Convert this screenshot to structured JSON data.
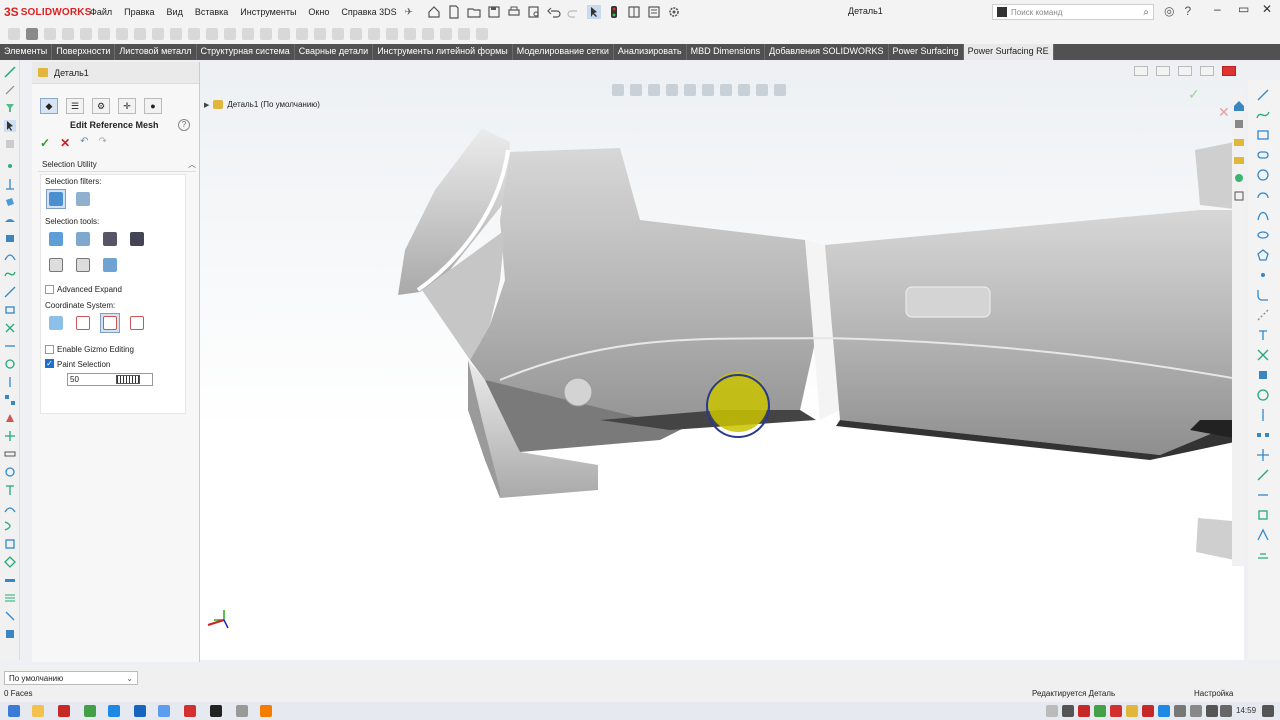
{
  "app": {
    "logo_ds": "3S",
    "logo_name": "SOLIDWORKS",
    "menu": [
      "Файл",
      "Правка",
      "Вид",
      "Вставка",
      "Инструменты",
      "Окно",
      "Справка 3DS"
    ],
    "doc_title": "Деталь1",
    "search_placeholder": "Поиск команд"
  },
  "tabs": [
    {
      "label": "Элементы",
      "active": false
    },
    {
      "label": "Поверхности",
      "active": false
    },
    {
      "label": "Листовой металл",
      "active": false
    },
    {
      "label": "Структурная система",
      "active": false
    },
    {
      "label": "Сварные детали",
      "active": false
    },
    {
      "label": "Инструменты литейной формы",
      "active": false
    },
    {
      "label": "Моделирование сетки",
      "active": false
    },
    {
      "label": "Анализировать",
      "active": false
    },
    {
      "label": "MBD Dimensions",
      "active": false
    },
    {
      "label": "Добавления SOLIDWORKS",
      "active": false
    },
    {
      "label": "Power Surfacing",
      "active": false
    },
    {
      "label": "Power Surfacing RE",
      "active": true
    }
  ],
  "pm": {
    "tree_root": "Деталь1",
    "title": "Edit Reference Mesh",
    "group_title": "Selection Utility",
    "selection_filters_label": "Selection filters:",
    "selection_tools_label": "Selection tools:",
    "advanced_expand_label": "Advanced Expand",
    "advanced_expand_checked": false,
    "coordinate_system_label": "Coordinate System:",
    "enable_gizmo_label": "Enable Gizmo Editing",
    "enable_gizmo_checked": false,
    "paint_selection_label": "Paint Selection",
    "paint_selection_checked": true,
    "paint_value": "50"
  },
  "viewport": {
    "tree_label": "Деталь1  (По умолчанию)"
  },
  "bottom": {
    "config_value": "По умолчанию",
    "faces": "0 Faces",
    "editing": "Редактируется Деталь",
    "custom": "Настройка"
  },
  "taskbar": {
    "clock": "14:59"
  },
  "colors": {
    "tab_bar": "#515151",
    "brand_red": "#d22222",
    "selection_blue": "#1e6fd0",
    "paint_brush": "#c9c400",
    "mesh_gray": "#b8b8b8"
  }
}
